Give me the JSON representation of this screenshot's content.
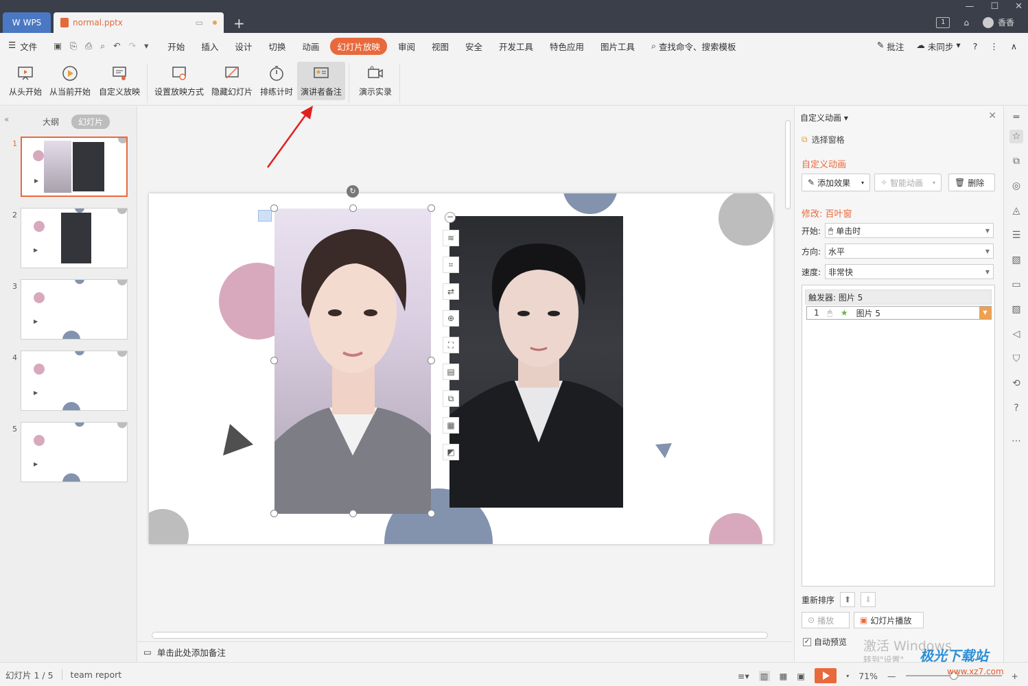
{
  "titlebar": {
    "wps_tab": "WPS",
    "doc_tab": "normal.pptx",
    "new_tab": "+",
    "badge": "1",
    "user": "香香"
  },
  "menu": {
    "file": "文件",
    "items": [
      "开始",
      "插入",
      "设计",
      "切换",
      "动画",
      "幻灯片放映",
      "审阅",
      "视图",
      "安全",
      "开发工具",
      "特色应用",
      "图片工具"
    ],
    "active_index": 5,
    "search": "查找命令、搜索模板",
    "review": "批注",
    "sync": "未同步",
    "help": "?"
  },
  "ribbon": {
    "buttons": [
      "从头开始",
      "从当前开始",
      "自定义放映",
      "设置放映方式",
      "隐藏幻灯片",
      "排练计时",
      "演讲者备注",
      "演示实录"
    ]
  },
  "left_panel": {
    "tab_outline": "大纲",
    "tab_slides": "幻灯片",
    "slides": [
      "1",
      "2",
      "3",
      "4",
      "5"
    ]
  },
  "notes": {
    "placeholder": "单击此处添加备注"
  },
  "right_pane": {
    "title": "自定义动画",
    "select_pane": "选择窗格",
    "heading": "自定义动画",
    "add_effect": "添加效果",
    "smart_anim": "智能动画",
    "delete": "删除",
    "modify": "修改: 百叶窗",
    "start_label": "开始:",
    "start_value": "单击时",
    "direction_label": "方向:",
    "direction_value": "水平",
    "speed_label": "速度:",
    "speed_value": "非常快",
    "trigger": "触发器: 图片 5",
    "item_index": "1",
    "item_name": "图片 5",
    "reorder": "重新排序",
    "play": "播放",
    "slideshow": "幻灯片播放",
    "auto_preview": "自动预览"
  },
  "status": {
    "slide_info": "幻灯片 1 / 5",
    "theme": "team report",
    "zoom": "71%"
  },
  "watermark": {
    "line1": "激活 Windows",
    "line2": "转到\"设置\"",
    "site": "极光下载站",
    "url": "www.xz7.com"
  },
  "colors": {
    "accent": "#e8693c",
    "titlebar": "#3b3f4a",
    "pink": "#d8a9bd",
    "blue_gray": "#8393ae",
    "gray": "#bdbdbd"
  }
}
